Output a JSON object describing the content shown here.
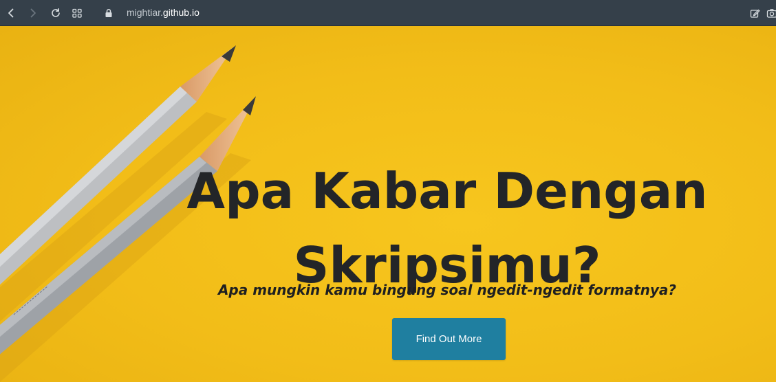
{
  "browser": {
    "url_prefix": "mightiar.",
    "url_host": "github.io",
    "icons": [
      "back-icon",
      "forward-icon",
      "reload-icon",
      "tab-grid-icon",
      "lock-icon",
      "edit-icon",
      "camera-icon"
    ]
  },
  "hero": {
    "title_line1": "Apa Kabar Dengan",
    "title_line2": "Skripsimu?",
    "subtitle": "Apa mungkin kamu bingung soal ngedit-ngedit formatnya?",
    "button_label": "Find Out More"
  },
  "colors": {
    "toolbar": "#35404a",
    "background_yellow": "#f3c21c",
    "button": "#1f7fa0",
    "text_dark": "#232528"
  }
}
